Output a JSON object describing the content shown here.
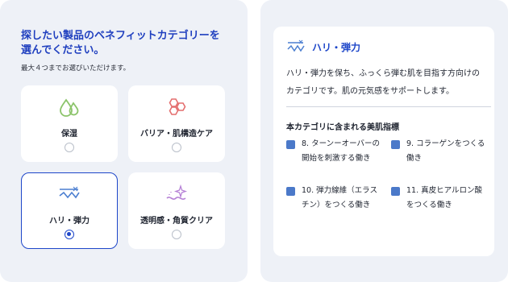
{
  "question": {
    "title": "探したい製品のベネフィットカテゴリーを選んでください。",
    "hint": "最大４つまでお選びいただけます。"
  },
  "categories": [
    {
      "label": "保湿",
      "icon": "water-drops-icon",
      "selected": false
    },
    {
      "label": "バリア・肌構造ケア",
      "icon": "hexagon-cells-icon",
      "selected": false
    },
    {
      "label": "ハリ・弾力",
      "icon": "firmness-wave-icon",
      "selected": true
    },
    {
      "label": "透明感・角質クリア",
      "icon": "sparkle-wave-icon",
      "selected": false
    }
  ],
  "detail": {
    "title": "ハリ・弾力",
    "description": "ハリ・弾力を保ち、ふっくら弾む肌を目指す方向けのカテゴリです。肌の元気感をサポートします。",
    "indicators_heading": "本カテゴリに含まれる美肌指標",
    "indicators": [
      {
        "label": "8. ターンーオーバーの開始を刺激する働き"
      },
      {
        "label": "9. コラーゲンをつくる働き"
      },
      {
        "label": "10. 弾力線維（エラスチン）をつくる働き"
      },
      {
        "label": "11. 真皮ヒアルロン酸をつくる働き"
      }
    ]
  },
  "colors": {
    "accent": "#1d46c9",
    "panel_bg": "#eef1f7",
    "indicator_box": "#4b79c9",
    "moisture_icon": "#8cc46b",
    "barrier_icon": "#e46f6f",
    "firmness_icon": "#4c7fd1",
    "clarity_icon": "#b681d6"
  }
}
